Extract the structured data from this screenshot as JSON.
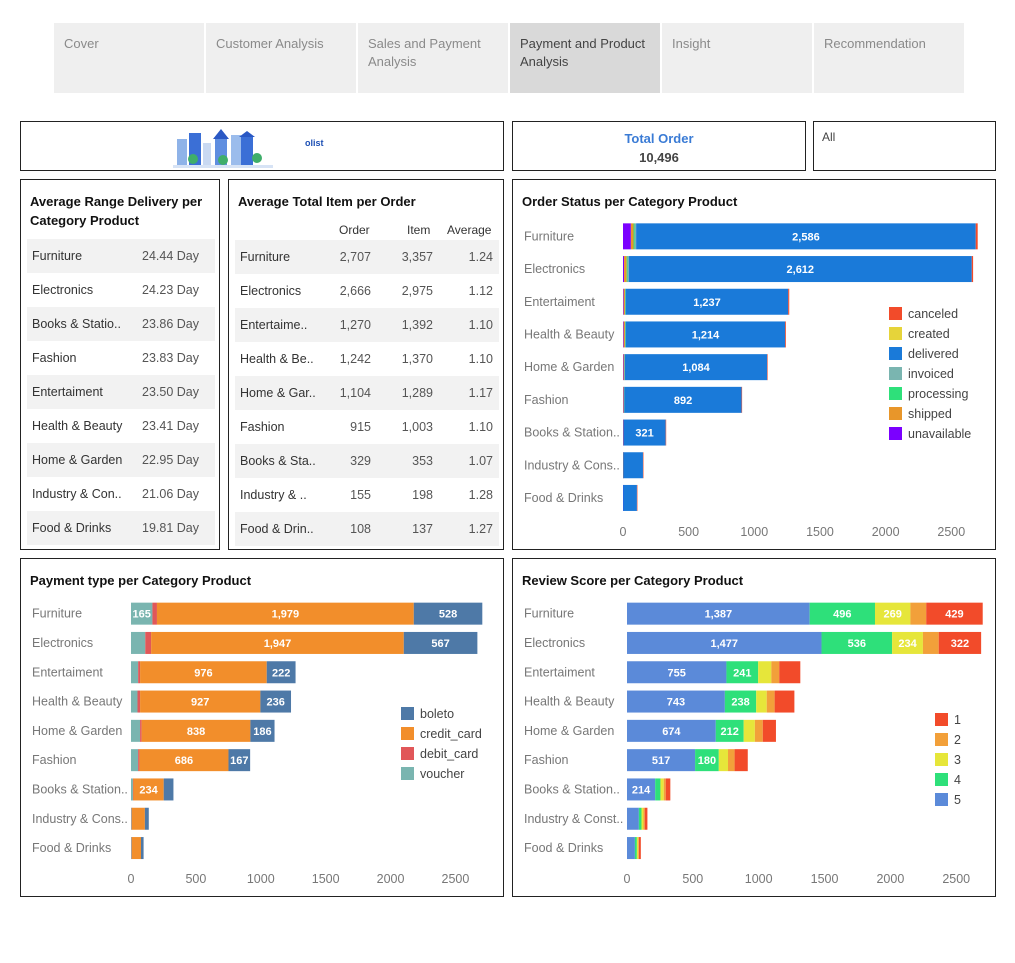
{
  "tabs": [
    {
      "label": "Cover"
    },
    {
      "label": "Customer Analysis"
    },
    {
      "label": "Sales and Payment Analysis"
    },
    {
      "label": "Payment and Product Analysis"
    },
    {
      "label": "Insight"
    },
    {
      "label": "Recommendation"
    }
  ],
  "logo": {
    "brand": "olist"
  },
  "total_order": {
    "label": "Total Order",
    "value": "10,496"
  },
  "filter": {
    "value": "All"
  },
  "delivery_table": {
    "title": "Average Range Delivery per Category Product",
    "rows": [
      {
        "category": "Furniture",
        "value": "24.44 Day"
      },
      {
        "category": "Electronics",
        "value": "24.23 Day"
      },
      {
        "category": "Books & Statio..",
        "value": "23.86 Day"
      },
      {
        "category": "Fashion",
        "value": "23.83 Day"
      },
      {
        "category": "Entertaiment",
        "value": "23.50 Day"
      },
      {
        "category": "Health & Beauty",
        "value": "23.41 Day"
      },
      {
        "category": "Home & Garden",
        "value": "22.95 Day"
      },
      {
        "category": "Industry & Con..",
        "value": "21.06 Day"
      },
      {
        "category": "Food & Drinks",
        "value": "19.81 Day"
      }
    ]
  },
  "item_table": {
    "title": "Average Total Item per Order",
    "headers": [
      "Order",
      "Item",
      "Average"
    ],
    "rows": [
      {
        "category": "Furniture",
        "order": "2,707",
        "item": "3,357",
        "avg": "1.24"
      },
      {
        "category": "Electronics",
        "order": "2,666",
        "item": "2,975",
        "avg": "1.12"
      },
      {
        "category": "Entertaime..",
        "order": "1,270",
        "item": "1,392",
        "avg": "1.10"
      },
      {
        "category": "Health & Be..",
        "order": "1,242",
        "item": "1,370",
        "avg": "1.10"
      },
      {
        "category": "Home & Gar..",
        "order": "1,104",
        "item": "1,289",
        "avg": "1.17"
      },
      {
        "category": "Fashion",
        "order": "915",
        "item": "1,003",
        "avg": "1.10"
      },
      {
        "category": "Books & Sta..",
        "order": "329",
        "item": "353",
        "avg": "1.07"
      },
      {
        "category": "Industry & ..",
        "order": "155",
        "item": "198",
        "avg": "1.28"
      },
      {
        "category": "Food & Drin..",
        "order": "108",
        "item": "137",
        "avg": "1.27"
      }
    ]
  },
  "chart_data": [
    {
      "id": "order_status",
      "type": "bar",
      "orientation": "horizontal",
      "stacked": true,
      "title": "Order Status per Category Product",
      "categories": [
        "Furniture",
        "Electronics",
        "Entertaiment",
        "Health & Beauty",
        "Home & Garden",
        "Fashion",
        "Books & Station..",
        "Industry & Cons..",
        "Food & Drinks"
      ],
      "series": [
        {
          "name": "unavailable",
          "color": "#7b00ff",
          "values": [
            60,
            8,
            5,
            5,
            4,
            3,
            2,
            1,
            1
          ]
        },
        {
          "name": "shipped",
          "color": "#e8962a",
          "values": [
            20,
            20,
            10,
            10,
            6,
            4,
            2,
            1,
            0
          ]
        },
        {
          "name": "processing",
          "color": "#2ee07a",
          "values": [
            8,
            6,
            3,
            3,
            2,
            2,
            0,
            0,
            0
          ]
        },
        {
          "name": "invoiced",
          "color": "#7ab5b0",
          "values": [
            12,
            10,
            3,
            3,
            2,
            2,
            0,
            0,
            0
          ]
        },
        {
          "name": "delivered",
          "color": "#1a7ad9",
          "values": [
            2586,
            2612,
            1237,
            1214,
            1084,
            892,
            321,
            150,
            105
          ]
        },
        {
          "name": "created",
          "color": "#e6d43a",
          "values": [
            0,
            0,
            0,
            0,
            0,
            0,
            0,
            0,
            0
          ]
        },
        {
          "name": "canceled",
          "color": "#f24b2a",
          "values": [
            15,
            10,
            8,
            6,
            4,
            4,
            3,
            2,
            1
          ]
        }
      ],
      "legend_order": [
        "canceled",
        "created",
        "delivered",
        "invoiced",
        "processing",
        "shipped",
        "unavailable"
      ],
      "xlim": [
        0,
        2650
      ],
      "xticks": [
        0,
        500,
        1000,
        1500,
        2000,
        2500
      ],
      "labeled_series": "delivered",
      "label_min": 300
    },
    {
      "id": "payment_type",
      "type": "bar",
      "orientation": "horizontal",
      "stacked": true,
      "title": "Payment type per Category Product",
      "categories": [
        "Furniture",
        "Electronics",
        "Entertaiment",
        "Health & Beauty",
        "Home & Garden",
        "Fashion",
        "Books & Station..",
        "Industry & Cons..",
        "Food & Drinks"
      ],
      "series": [
        {
          "name": "voucher",
          "color": "#7ab5b0",
          "values": [
            165,
            110,
            55,
            50,
            70,
            55,
            15,
            5,
            5
          ]
        },
        {
          "name": "debit_card",
          "color": "#e15759",
          "values": [
            35,
            45,
            15,
            20,
            12,
            10,
            3,
            2,
            2
          ]
        },
        {
          "name": "credit_card",
          "color": "#f28e2b",
          "values": [
            1979,
            1947,
            976,
            927,
            838,
            686,
            234,
            100,
            70
          ]
        },
        {
          "name": "boleto",
          "color": "#4e79a7",
          "values": [
            528,
            567,
            222,
            236,
            186,
            167,
            75,
            30,
            20
          ]
        }
      ],
      "legend_order": [
        "boleto",
        "credit_card",
        "debit_card",
        "voucher"
      ],
      "xlim": [
        0,
        2720
      ],
      "xticks": [
        0,
        500,
        1000,
        1500,
        2000,
        2500
      ],
      "label_min": 150
    },
    {
      "id": "review_score",
      "type": "bar",
      "orientation": "horizontal",
      "stacked": true,
      "title": "Review Score per Category Product",
      "categories": [
        "Furniture",
        "Electronics",
        "Entertaiment",
        "Health & Beauty",
        "Home & Garden",
        "Fashion",
        "Books & Station..",
        "Industry & Const..",
        "Food & Drinks"
      ],
      "series": [
        {
          "name": "5",
          "color": "#5b8ad9",
          "values": [
            1387,
            1477,
            755,
            743,
            674,
            517,
            214,
            90,
            60
          ]
        },
        {
          "name": "4",
          "color": "#2ee07a",
          "values": [
            496,
            536,
            241,
            238,
            212,
            180,
            40,
            20,
            15
          ]
        },
        {
          "name": "3",
          "color": "#e6e63a",
          "values": [
            269,
            234,
            100,
            80,
            85,
            70,
            25,
            15,
            10
          ]
        },
        {
          "name": "2",
          "color": "#f2a03a",
          "values": [
            120,
            120,
            60,
            60,
            60,
            50,
            15,
            10,
            5
          ]
        },
        {
          "name": "1",
          "color": "#f24b2a",
          "values": [
            429,
            322,
            160,
            150,
            100,
            100,
            35,
            20,
            15
          ]
        }
      ],
      "legend_order": [
        "1",
        "2",
        "3",
        "4",
        "5"
      ],
      "xlim": [
        0,
        2650
      ],
      "xticks": [
        0,
        500,
        1000,
        1500,
        2000,
        2500
      ],
      "label_min": 170
    }
  ]
}
